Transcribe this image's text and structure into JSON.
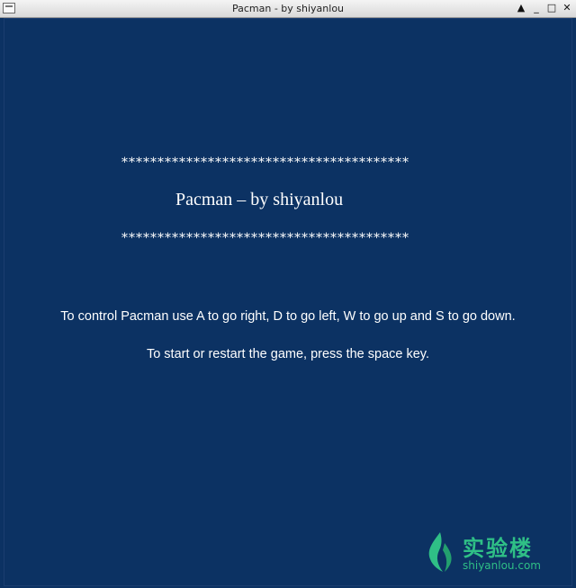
{
  "window": {
    "title": "Pacman - by shiyanlou",
    "controls": {
      "shade": "▲",
      "minimize": "_",
      "maximize": "□",
      "close": "✕"
    }
  },
  "intro": {
    "stars_line": "****************************************",
    "title": "Pacman – by shiyanlou",
    "instruction_controls": "To control Pacman use A to go right, D to go left, W to go up and S to go down.",
    "instruction_start": "To start or restart the game, press the space key."
  },
  "watermark": {
    "brand": "实验楼",
    "url": "shiyanlou.com"
  },
  "colors": {
    "background": "#0c3263",
    "text": "#ffffff",
    "watermark": "#2fbf86"
  }
}
